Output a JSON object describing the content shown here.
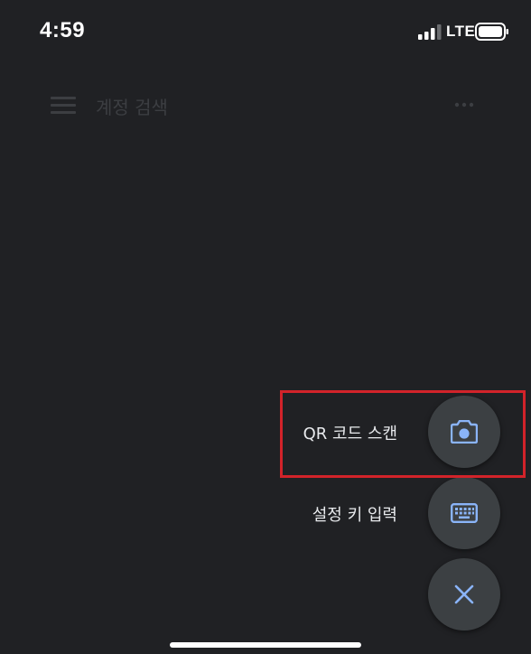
{
  "status_bar": {
    "time": "4:59",
    "network": "LTE",
    "signal_icon": "cellular-signal-icon",
    "battery_icon": "battery-icon"
  },
  "app_bar": {
    "menu_icon": "hamburger-menu-icon",
    "search_placeholder": "계정 검색",
    "more_icon": "more-horizontal-icon"
  },
  "speed_dial": {
    "actions": [
      {
        "label": "QR 코드 스캔",
        "icon": "camera-icon"
      },
      {
        "label": "설정 키 입력",
        "icon": "keyboard-icon"
      }
    ],
    "close_icon": "close-icon"
  },
  "colors": {
    "background": "#202124",
    "fab_background": "#3c4043",
    "icon_accent": "#8ab4f8",
    "label_text": "#e8eaed",
    "highlight": "#d2232a"
  }
}
